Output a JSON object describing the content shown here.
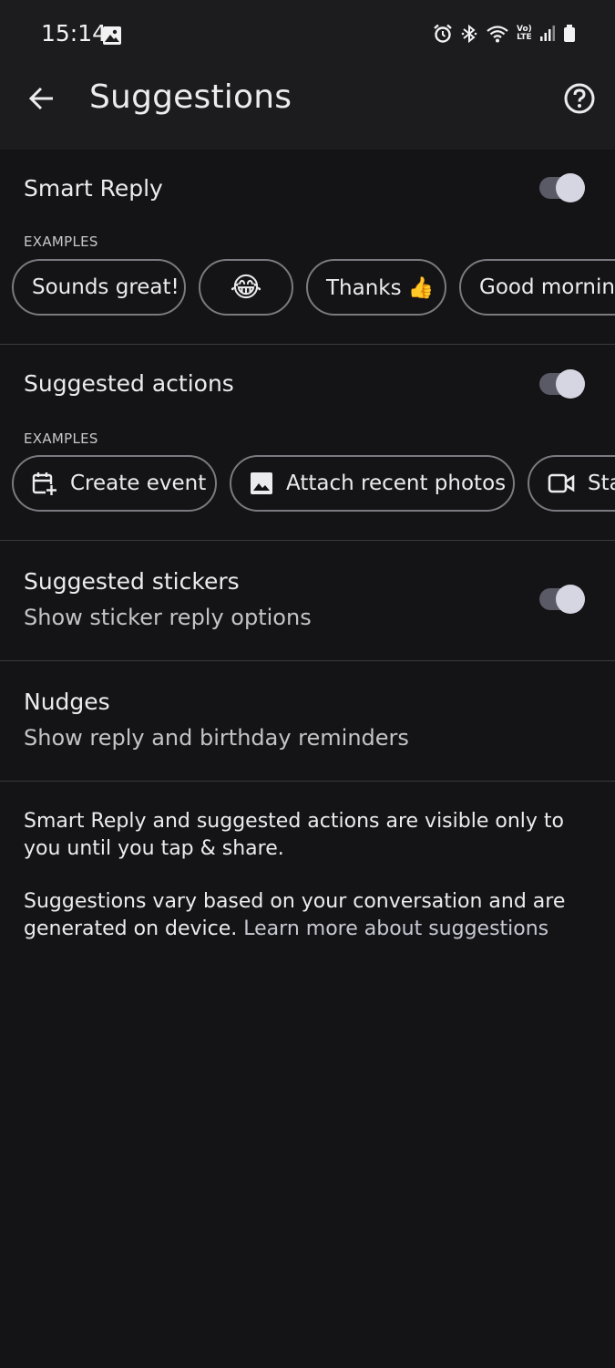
{
  "status_bar": {
    "time": "15:14",
    "volte_top": "Vo)",
    "volte_bottom": "LTE"
  },
  "app_bar": {
    "title": "Suggestions",
    "back_icon": "arrow-left-icon",
    "help_icon": "help-circle-icon"
  },
  "smart_reply": {
    "title": "Smart Reply",
    "enabled": true,
    "examples_label": "EXAMPLES",
    "chips": [
      {
        "label": "Sounds great!"
      },
      {
        "label": "😂"
      },
      {
        "label": "Thanks 👍"
      },
      {
        "label": "Good morning"
      }
    ]
  },
  "suggested_actions": {
    "title": "Suggested actions",
    "enabled": true,
    "examples_label": "EXAMPLES",
    "chips": [
      {
        "label": "Create event",
        "icon": "calendar-add-icon"
      },
      {
        "label": "Attach recent photos",
        "icon": "image-icon"
      },
      {
        "label": "Sta",
        "icon": "video-camera-icon"
      }
    ]
  },
  "suggested_stickers": {
    "title": "Suggested stickers",
    "subtitle": "Show sticker reply options",
    "enabled": true
  },
  "nudges": {
    "title": "Nudges",
    "subtitle": "Show reply and birthday reminders"
  },
  "footer": {
    "paragraph1": "Smart Reply and suggested actions are visible only to you until you tap & share.",
    "paragraph2": "Suggestions vary based on your conversation and are generated on device.",
    "learn_more": "Learn more about suggestions"
  },
  "colors": {
    "background": "#141416",
    "app_bar": "#1c1c1e",
    "toggle_track": "#5a5a66",
    "toggle_thumb": "#d6d6e2",
    "chip_border": "#7a7a80"
  }
}
